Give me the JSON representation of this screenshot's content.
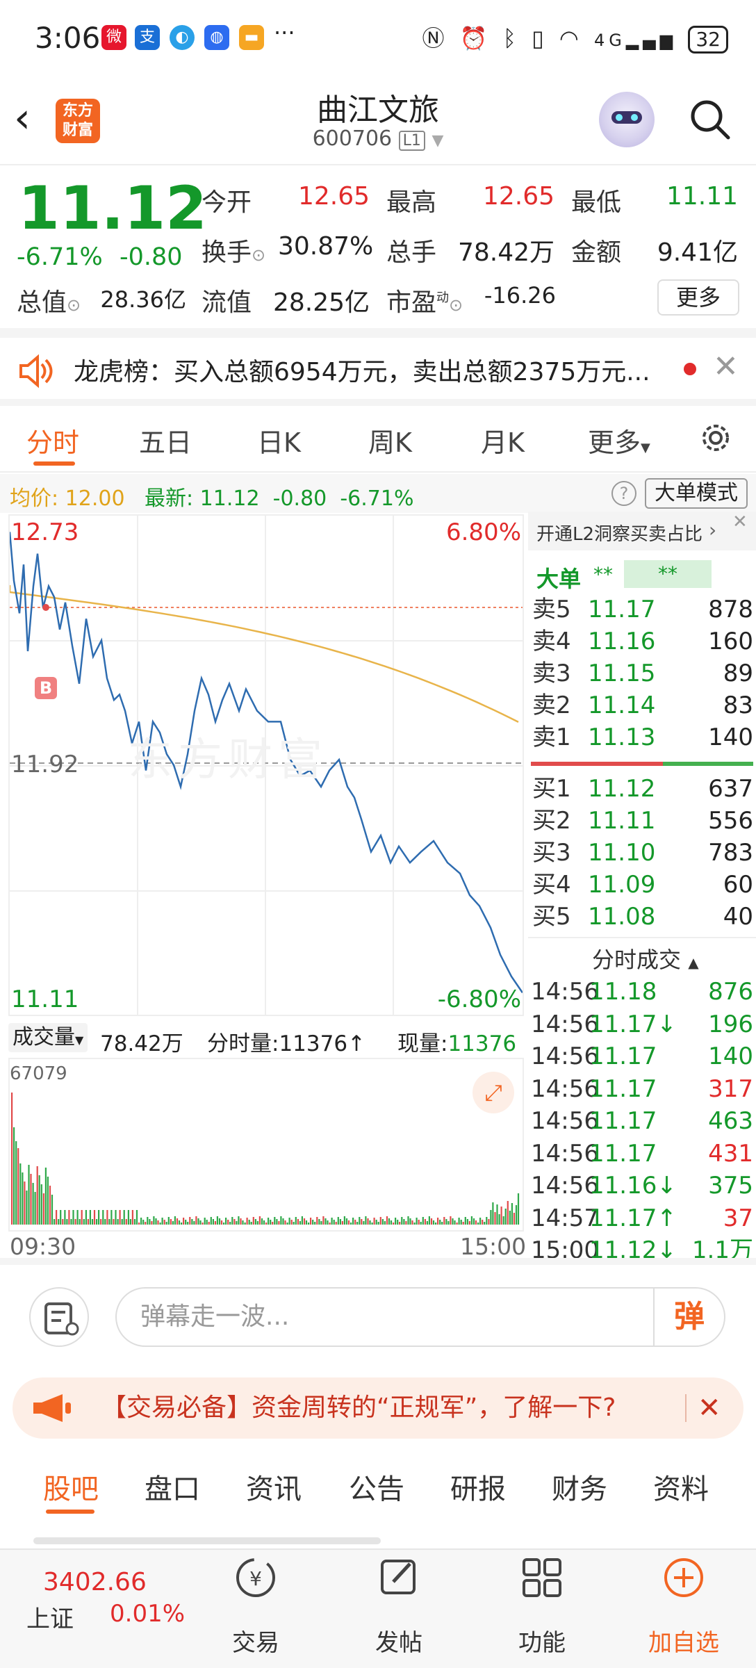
{
  "status_bar": {
    "time": "3:06",
    "more": "···",
    "battery": "32",
    "network": "4G"
  },
  "header": {
    "title": "曲江文旅",
    "code": "600706",
    "level": "L1",
    "logo_text": "东方财富"
  },
  "quote": {
    "price": "11.12",
    "change_pct": "-6.71%",
    "change": "-0.80",
    "open_label": "今开",
    "open": "12.65",
    "high_label": "最高",
    "high": "12.65",
    "low_label": "最低",
    "low": "11.11",
    "turnover_label": "换手",
    "turnover": "30.87%",
    "volume_label": "总手",
    "volume": "78.42万",
    "amount_label": "金额",
    "amount": "9.41亿",
    "mcap_label": "总值",
    "mcap": "28.36亿",
    "float_label": "流值",
    "float": "28.25亿",
    "pe_label": "市盈",
    "pe_sup": "动",
    "pe": "-16.26",
    "more_button": "更多"
  },
  "notice": {
    "text": "龙虎榜：买入总额6954万元，卖出总额2375万元..."
  },
  "tabs": [
    "分时",
    "五日",
    "日K",
    "周K",
    "月K",
    "更多"
  ],
  "avg_bar": {
    "avg_label": "均价:",
    "avg": "12.00",
    "latest_label": "最新:",
    "latest": "11.12",
    "chg": "-0.80",
    "pct": "-6.71%",
    "mode_button": "大单模式"
  },
  "chart": {
    "high_price": "12.73",
    "high_pct": "6.80%",
    "low_price": "11.11",
    "low_pct": "-6.80%",
    "mid_price": "11.92",
    "watermark": "东方财富",
    "marker": "B",
    "time_start": "09:30",
    "time_end": "15:00"
  },
  "volume": {
    "label": "成交量",
    "total": "78.42万",
    "minute_label": "分时量:",
    "minute_value": "11376↑",
    "now_label": "现量:",
    "now_value": "11376",
    "max": "67079"
  },
  "l2": {
    "promo": "开通L2洞察买卖占比",
    "big_label": "大单",
    "big_a": "**",
    "big_b": "**"
  },
  "asks": [
    {
      "label": "卖5",
      "price": "11.17",
      "vol": "878"
    },
    {
      "label": "卖4",
      "price": "11.16",
      "vol": "160"
    },
    {
      "label": "卖3",
      "price": "11.15",
      "vol": "89"
    },
    {
      "label": "卖2",
      "price": "11.14",
      "vol": "83"
    },
    {
      "label": "卖1",
      "price": "11.13",
      "vol": "140"
    }
  ],
  "bids": [
    {
      "label": "买1",
      "price": "11.12",
      "vol": "637"
    },
    {
      "label": "买2",
      "price": "11.11",
      "vol": "556"
    },
    {
      "label": "买3",
      "price": "11.10",
      "vol": "783"
    },
    {
      "label": "买4",
      "price": "11.09",
      "vol": "60"
    },
    {
      "label": "买5",
      "price": "11.08",
      "vol": "40"
    }
  ],
  "trades_header": "分时成交",
  "trades": [
    {
      "time": "14:56",
      "price": "11.18",
      "vol": "876",
      "vcolor": "#14982a"
    },
    {
      "time": "14:56",
      "price": "11.17↓",
      "vol": "196",
      "vcolor": "#14982a"
    },
    {
      "time": "14:56",
      "price": "11.17",
      "vol": "140",
      "vcolor": "#14982a"
    },
    {
      "time": "14:56",
      "price": "11.17",
      "vol": "317",
      "vcolor": "#e12b2b"
    },
    {
      "time": "14:56",
      "price": "11.17",
      "vol": "463",
      "vcolor": "#14982a"
    },
    {
      "time": "14:56",
      "price": "11.17",
      "vol": "431",
      "vcolor": "#e12b2b"
    },
    {
      "time": "14:56",
      "price": "11.16↓",
      "vol": "375",
      "vcolor": "#14982a"
    },
    {
      "time": "14:57",
      "price": "11.17↑",
      "vol": "37",
      "vcolor": "#e12b2b"
    },
    {
      "time": "15:00",
      "price": "11.12↓",
      "vol": "1.1万",
      "vcolor": "#14982a"
    }
  ],
  "comment": {
    "placeholder": "弹幕走一波...",
    "danmu_button": "弹"
  },
  "banner": {
    "text": "【交易必备】资金周转的“正规军”，了解一下?"
  },
  "bottom_tabs": [
    "股吧",
    "盘口",
    "资讯",
    "公告",
    "研报",
    "财务",
    "资料"
  ],
  "nav": {
    "index_value": "3402.66",
    "index_name": "上证",
    "index_pct": "0.01%",
    "trade": "交易",
    "post": "发帖",
    "func": "功能",
    "add": "加自选"
  }
}
